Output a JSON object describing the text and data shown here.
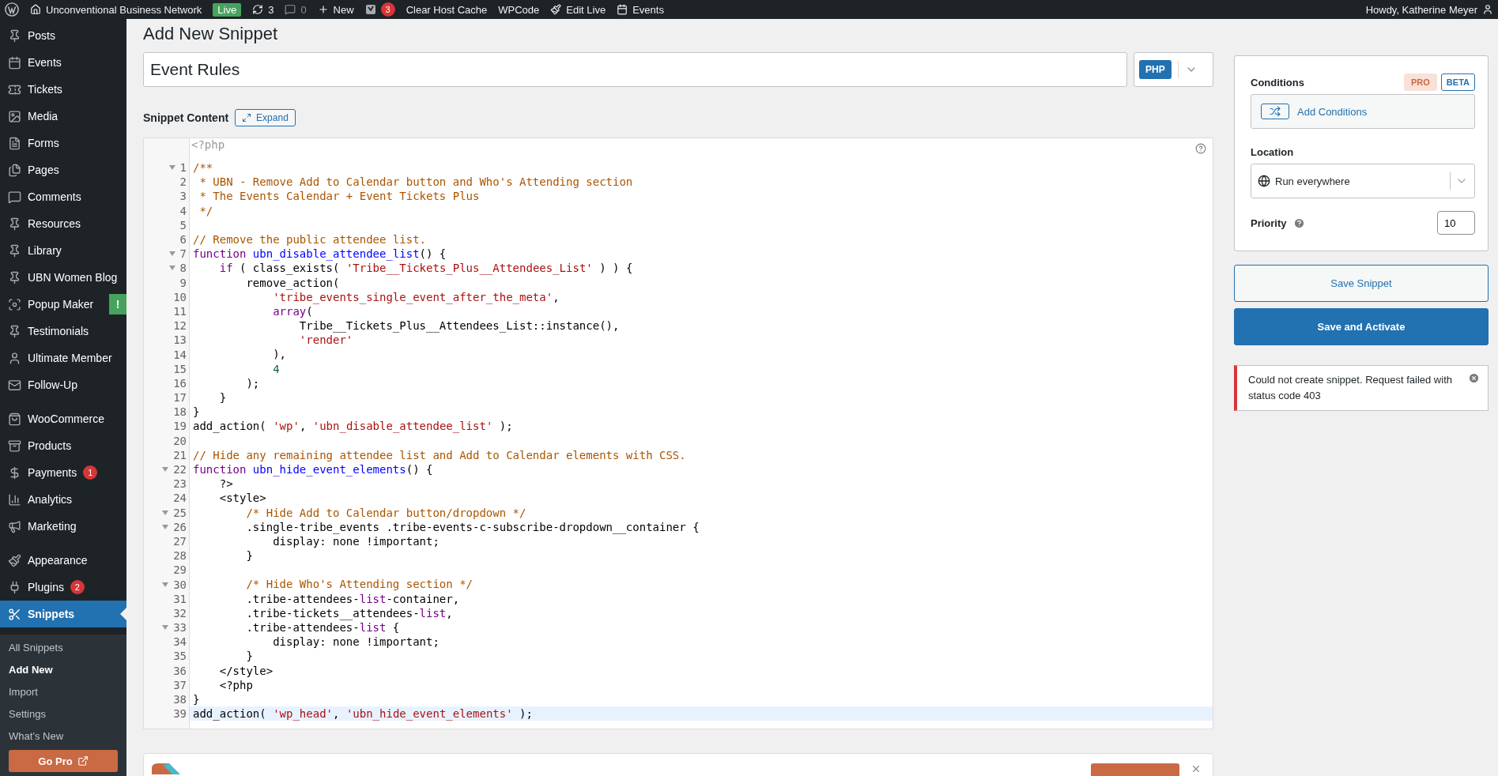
{
  "admin_bar": {
    "items": [
      {
        "kind": "logo"
      },
      {
        "kind": "site",
        "label": "Unconventional Business Network"
      },
      {
        "kind": "env",
        "label": "Live"
      },
      {
        "kind": "updates",
        "label": "3"
      },
      {
        "kind": "comments",
        "label": "0"
      },
      {
        "kind": "new",
        "label": "New"
      },
      {
        "kind": "seo",
        "label": "3"
      },
      {
        "kind": "link",
        "label": "Clear Host Cache"
      },
      {
        "kind": "link",
        "label": "WPCode"
      },
      {
        "kind": "edit",
        "label": "Edit Live"
      },
      {
        "kind": "events",
        "label": "Events"
      }
    ],
    "greeting": "Howdy, Katherine Meyer"
  },
  "sidebar": {
    "groups": [
      [
        {
          "label": "Posts",
          "selected": false
        },
        {
          "label": "Events",
          "selected": false
        },
        {
          "label": "Tickets",
          "selected": false
        },
        {
          "label": "Media",
          "selected": false
        },
        {
          "label": "Forms",
          "selected": false
        },
        {
          "label": "Pages",
          "selected": false
        },
        {
          "label": "Comments",
          "selected": false
        },
        {
          "label": "Resources",
          "selected": false
        },
        {
          "label": "Library",
          "selected": false
        },
        {
          "label": "UBN Women Blog",
          "selected": false
        },
        {
          "label": "Popup Maker",
          "selected": false,
          "alert": "!"
        },
        {
          "label": "Testimonials",
          "selected": false
        },
        {
          "label": "Ultimate Member",
          "selected": false
        },
        {
          "label": "Follow-Up",
          "selected": false
        }
      ],
      [
        {
          "label": "WooCommerce",
          "selected": false
        },
        {
          "label": "Products",
          "selected": false
        },
        {
          "label": "Payments",
          "selected": false,
          "count": "1"
        },
        {
          "label": "Analytics",
          "selected": false
        },
        {
          "label": "Marketing",
          "selected": false
        }
      ],
      [
        {
          "label": "Appearance",
          "selected": false
        },
        {
          "label": "Plugins",
          "selected": false,
          "count": "2"
        },
        {
          "label": "Snippets",
          "selected": true
        }
      ]
    ],
    "submenu": [
      {
        "label": "All Snippets",
        "selected": false
      },
      {
        "label": "Add New",
        "selected": true
      },
      {
        "label": "Import",
        "selected": false
      },
      {
        "label": "Settings",
        "selected": false
      },
      {
        "label": "What’s New",
        "selected": false
      }
    ],
    "cta": "Go Pro"
  },
  "page": {
    "title": "Add New Snippet",
    "snippet_title": "Event Rules",
    "language": "PHP",
    "content_label": "Snippet Content",
    "expand": "Expand"
  },
  "editor": {
    "header": "<?php",
    "lines": [
      {
        "n": "1",
        "fold": true,
        "active": false,
        "tokens": [
          {
            "kind": "comment",
            "text": "/**"
          }
        ]
      },
      {
        "n": "2",
        "fold": false,
        "active": false,
        "tokens": [
          {
            "kind": "comment",
            "text": " * UBN - Remove Add to Calendar button and Who's Attending section"
          }
        ]
      },
      {
        "n": "3",
        "fold": false,
        "active": false,
        "tokens": [
          {
            "kind": "comment",
            "text": " * The Events Calendar + Event Tickets Plus"
          }
        ]
      },
      {
        "n": "4",
        "fold": false,
        "active": false,
        "tokens": [
          {
            "kind": "comment",
            "text": " */"
          }
        ]
      },
      {
        "n": "5",
        "fold": false,
        "active": false
      },
      {
        "n": "6",
        "fold": false,
        "active": false,
        "tokens": [
          {
            "kind": "comment",
            "text": "// Remove the public attendee list."
          }
        ]
      },
      {
        "n": "7",
        "fold": true,
        "active": false,
        "tokens": [
          {
            "kind": "keyword",
            "text": "function "
          },
          {
            "kind": "def",
            "text": "ubn_disable_attendee_list"
          },
          {
            "kind": "plain",
            "text": "() {"
          }
        ]
      },
      {
        "n": "8",
        "fold": true,
        "active": false,
        "tokens": [
          {
            "kind": "keyword",
            "text": "    if"
          },
          {
            "kind": "plain",
            "text": " ( class_exists( "
          },
          {
            "kind": "string",
            "text": "'Tribe__Tickets_Plus__Attendees_List'"
          },
          {
            "kind": "plain",
            "text": " ) ) {"
          }
        ]
      },
      {
        "n": "9",
        "fold": false,
        "active": false,
        "tokens": [
          {
            "kind": "plain",
            "text": "        remove_action("
          }
        ]
      },
      {
        "n": "10",
        "fold": false,
        "active": false,
        "tokens": [
          {
            "kind": "string",
            "text": "            'tribe_events_single_event_after_the_meta'"
          },
          {
            "kind": "plain",
            "text": ","
          }
        ]
      },
      {
        "n": "11",
        "fold": false,
        "active": false,
        "tokens": [
          {
            "kind": "keyword",
            "text": "            array"
          },
          {
            "kind": "plain",
            "text": "("
          }
        ]
      },
      {
        "n": "12",
        "fold": false,
        "active": false,
        "tokens": [
          {
            "kind": "plain",
            "text": "                Tribe__Tickets_Plus__Attendees_List::instance(),"
          }
        ]
      },
      {
        "n": "13",
        "fold": false,
        "active": false,
        "tokens": [
          {
            "kind": "string",
            "text": "                'render'"
          }
        ]
      },
      {
        "n": "14",
        "fold": false,
        "active": false,
        "tokens": [
          {
            "kind": "plain",
            "text": "            ),"
          }
        ]
      },
      {
        "n": "15",
        "fold": false,
        "active": false,
        "tokens": [
          {
            "kind": "number",
            "text": "            4"
          }
        ]
      },
      {
        "n": "16",
        "fold": false,
        "active": false,
        "tokens": [
          {
            "kind": "plain",
            "text": "        );"
          }
        ]
      },
      {
        "n": "17",
        "fold": false,
        "active": false,
        "tokens": [
          {
            "kind": "plain",
            "text": "    }"
          }
        ]
      },
      {
        "n": "18",
        "fold": false,
        "active": false,
        "tokens": [
          {
            "kind": "plain",
            "text": "}"
          }
        ]
      },
      {
        "n": "19",
        "fold": false,
        "active": false,
        "tokens": [
          {
            "kind": "plain",
            "text": "add_action( "
          },
          {
            "kind": "string",
            "text": "'wp'"
          },
          {
            "kind": "plain",
            "text": ", "
          },
          {
            "kind": "string",
            "text": "'ubn_disable_attendee_list'"
          },
          {
            "kind": "plain",
            "text": " );"
          }
        ]
      },
      {
        "n": "20",
        "fold": false,
        "active": false
      },
      {
        "n": "21",
        "fold": false,
        "active": false,
        "tokens": [
          {
            "kind": "comment",
            "text": "// Hide any remaining attendee list and Add to Calendar elements with CSS."
          }
        ]
      },
      {
        "n": "22",
        "fold": true,
        "active": false,
        "tokens": [
          {
            "kind": "keyword",
            "text": "function "
          },
          {
            "kind": "def",
            "text": "ubn_hide_event_elements"
          },
          {
            "kind": "plain",
            "text": "() {"
          }
        ]
      },
      {
        "n": "23",
        "fold": false,
        "active": false,
        "tokens": [
          {
            "kind": "plain",
            "text": "    ?>"
          }
        ]
      },
      {
        "n": "24",
        "fold": false,
        "active": false,
        "tokens": [
          {
            "kind": "plain",
            "text": "    <style>"
          }
        ]
      },
      {
        "n": "25",
        "fold": true,
        "active": false,
        "tokens": [
          {
            "kind": "comment",
            "text": "        /* Hide Add to Calendar button/dropdown */"
          }
        ]
      },
      {
        "n": "26",
        "fold": true,
        "active": false,
        "tokens": [
          {
            "kind": "plain",
            "text": "        .single-tribe_events .tribe-events-c-subscribe-dropdown__container {"
          }
        ]
      },
      {
        "n": "27",
        "fold": false,
        "active": false,
        "tokens": [
          {
            "kind": "plain",
            "text": "            display: none !important;"
          }
        ]
      },
      {
        "n": "28",
        "fold": false,
        "active": false,
        "tokens": [
          {
            "kind": "plain",
            "text": "        }"
          }
        ]
      },
      {
        "n": "29",
        "fold": false,
        "active": false
      },
      {
        "n": "30",
        "fold": true,
        "active": false,
        "tokens": [
          {
            "kind": "comment",
            "text": "        /* Hide Who's Attending section */"
          }
        ]
      },
      {
        "n": "31",
        "fold": false,
        "active": false,
        "tokens": [
          {
            "kind": "plain",
            "text": "        .tribe-attendees-"
          },
          {
            "kind": "keyword",
            "text": "list"
          },
          {
            "kind": "plain",
            "text": "-container,"
          }
        ]
      },
      {
        "n": "32",
        "fold": false,
        "active": false,
        "tokens": [
          {
            "kind": "plain",
            "text": "        .tribe-tickets__attendees-"
          },
          {
            "kind": "keyword",
            "text": "list"
          },
          {
            "kind": "plain",
            "text": ","
          }
        ]
      },
      {
        "n": "33",
        "fold": true,
        "active": false,
        "tokens": [
          {
            "kind": "plain",
            "text": "        .tribe-attendees-"
          },
          {
            "kind": "keyword",
            "text": "list"
          },
          {
            "kind": "plain",
            "text": " {"
          }
        ]
      },
      {
        "n": "34",
        "fold": false,
        "active": false,
        "tokens": [
          {
            "kind": "plain",
            "text": "            display: none !important;"
          }
        ]
      },
      {
        "n": "35",
        "fold": false,
        "active": false,
        "tokens": [
          {
            "kind": "plain",
            "text": "        }"
          }
        ]
      },
      {
        "n": "36",
        "fold": false,
        "active": false,
        "tokens": [
          {
            "kind": "plain",
            "text": "    </style>"
          }
        ]
      },
      {
        "n": "37",
        "fold": false,
        "active": false,
        "tokens": [
          {
            "kind": "plain",
            "text": "    <?php"
          }
        ]
      },
      {
        "n": "38",
        "fold": false,
        "active": false,
        "tokens": [
          {
            "kind": "plain",
            "text": "}"
          }
        ]
      },
      {
        "n": "39",
        "fold": false,
        "active": true,
        "tokens": [
          {
            "kind": "plain",
            "text": "add_action( "
          },
          {
            "kind": "string",
            "text": "'wp_head'"
          },
          {
            "kind": "plain",
            "text": ", "
          },
          {
            "kind": "string",
            "text": "'ubn_hide_event_elements'"
          },
          {
            "kind": "plain",
            "text": " );"
          }
        ]
      }
    ]
  },
  "settings": {
    "conditions_label": "Conditions",
    "pro": "PRO",
    "beta": "BETA",
    "add_conditions": "Add Conditions",
    "location_label": "Location",
    "location": "Run everywhere",
    "priority_label": "Priority",
    "priority": "10"
  },
  "actions": {
    "save": "Save Snippet",
    "save_activate": "Save and Activate"
  },
  "notice": {
    "message": "Could not create snippet. Request failed with status code 403"
  }
}
